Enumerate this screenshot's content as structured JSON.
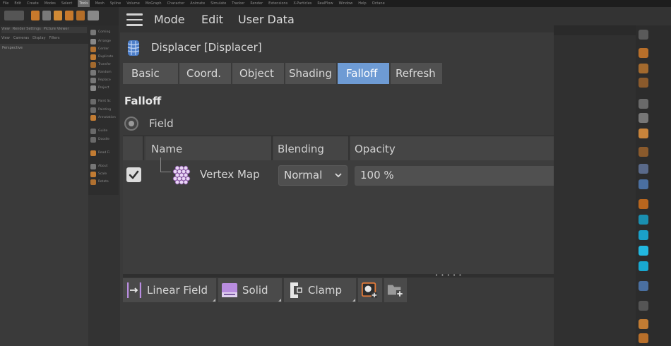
{
  "background_app": {
    "menubar_items": [
      "File",
      "Edit",
      "Create",
      "Modes",
      "Select",
      "Tools",
      "Mesh",
      "Spline",
      "Volume",
      "MoGraph",
      "Character",
      "Animate",
      "Simulate",
      "Tracker",
      "Render",
      "Extensions",
      "X-Particles",
      "RealFlow",
      "Window",
      "Help",
      "Octane"
    ],
    "viewport_tabs": [
      "View",
      "Render Settings",
      "Picture Viewer"
    ],
    "viewport_menu": [
      "View",
      "Cameras",
      "Display",
      "Filters"
    ],
    "viewport_name": "Perspective",
    "palette_labels": [
      "Coming",
      "Arrange",
      "Center",
      "Duplicate",
      "Transfer",
      "Random",
      "Replace",
      "Project",
      "Paint Sc",
      "Painting",
      "Annotation",
      "Guide",
      "Doodle",
      "Read Fi",
      "About",
      "Scale",
      "Rotate"
    ]
  },
  "attribute_manager": {
    "menu": {
      "hamburger_icon": "hamburger-icon",
      "items": [
        "Mode",
        "Edit",
        "User Data"
      ]
    },
    "object": {
      "icon": "displacer-icon",
      "title": "Displacer [Displacer]"
    },
    "tabs": [
      {
        "label": "Basic",
        "active": false
      },
      {
        "label": "Coord.",
        "active": false
      },
      {
        "label": "Object",
        "active": false
      },
      {
        "label": "Shading",
        "active": false
      },
      {
        "label": "Falloff",
        "active": true
      },
      {
        "label": "Refresh",
        "active": false
      }
    ],
    "section_title": "Falloff",
    "field_label": "Field",
    "field_list": {
      "columns": [
        "Name",
        "Blending",
        "Opacity"
      ],
      "rows": [
        {
          "enabled": true,
          "icon": "vertex-map-icon",
          "name": "Vertex Map",
          "blending": "Normal",
          "opacity": "100 %"
        }
      ]
    },
    "bottom_tools": [
      {
        "label": "Linear Field",
        "icon": "linear-field-icon"
      },
      {
        "label": "Solid",
        "icon": "solid-layer-icon"
      },
      {
        "label": "Clamp",
        "icon": "clamp-icon"
      },
      {
        "label": "",
        "icon": "add-layer-icon"
      },
      {
        "label": "",
        "icon": "add-folder-icon"
      }
    ],
    "accent_color": "#6e9bd4"
  }
}
